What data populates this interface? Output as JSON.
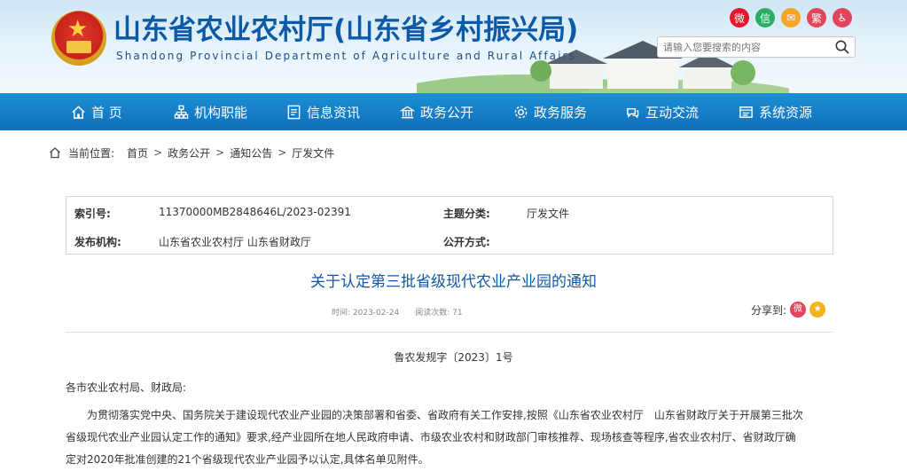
{
  "header": {
    "title": "山东省农业农村厅(山东省乡村振兴局)",
    "subtitle": "Shandong Provincial Department of Agriculture and Rural Affairs",
    "social_icons": [
      {
        "name": "weibo-icon",
        "glyph": "微",
        "color": "#e6162d"
      },
      {
        "name": "wechat-icon",
        "glyph": "信",
        "color": "#2aae67"
      },
      {
        "name": "mail-icon",
        "glyph": "✉",
        "color": "#f5a623"
      },
      {
        "name": "traditional-chinese",
        "glyph": "繁",
        "color": "#e2445c"
      },
      {
        "name": "accessibility-icon",
        "glyph": "♿",
        "color": "#e2445c"
      }
    ],
    "search_placeholder": "请输入您要搜索的内容"
  },
  "nav": [
    {
      "label": "首 页",
      "icon": "home-icon"
    },
    {
      "label": "机构职能",
      "icon": "org-icon"
    },
    {
      "label": "信息资讯",
      "icon": "info-icon"
    },
    {
      "label": "政务公开",
      "icon": "gov-open-icon"
    },
    {
      "label": "政务服务",
      "icon": "service-icon"
    },
    {
      "label": "互动交流",
      "icon": "interact-icon"
    },
    {
      "label": "系统资源",
      "icon": "system-icon"
    }
  ],
  "breadcrumb": {
    "prefix": "当前位置:",
    "items": [
      "首页",
      "政务公开",
      "通知公告",
      "厅发文件"
    ]
  },
  "info": {
    "index_label": "索引号:",
    "index_value": "11370000MB2848646L/2023-02391",
    "topic_label": "主题分类:",
    "topic_value": "厅发文件",
    "publisher_label": "发布机构:",
    "publisher_value": "山东省农业农村厅 山东省财政厅",
    "disclosure_label": "公开方式:",
    "disclosure_value": ""
  },
  "article": {
    "title": "关于认定第三批省级现代农业产业园的通知",
    "time": "时间: 2023-02-24",
    "views": "阅读次数: 71",
    "share_label": "分享到:",
    "doc_number": "鲁农发规字〔2023〕1号",
    "salutation": "各市农业农村局、财政局:",
    "paragraph_lines": [
      "为贯彻落实党中央、国务院关于建设现代农业产业园的决策部署和省委、省政府有关工作安排,按照《山东省农业农村厅　山东省财政厅关于开展第三批次",
      "省级现代农业产业园认定工作的通知》要求,经产业园所在地人民政府申请、市级农业农村和财政部门审核推荐、现场核查等程序,省农业农村厅、省财政厅确",
      "定对2020年批准创建的21个省级现代农业产业园予以认定,具体名单见附件。"
    ]
  }
}
